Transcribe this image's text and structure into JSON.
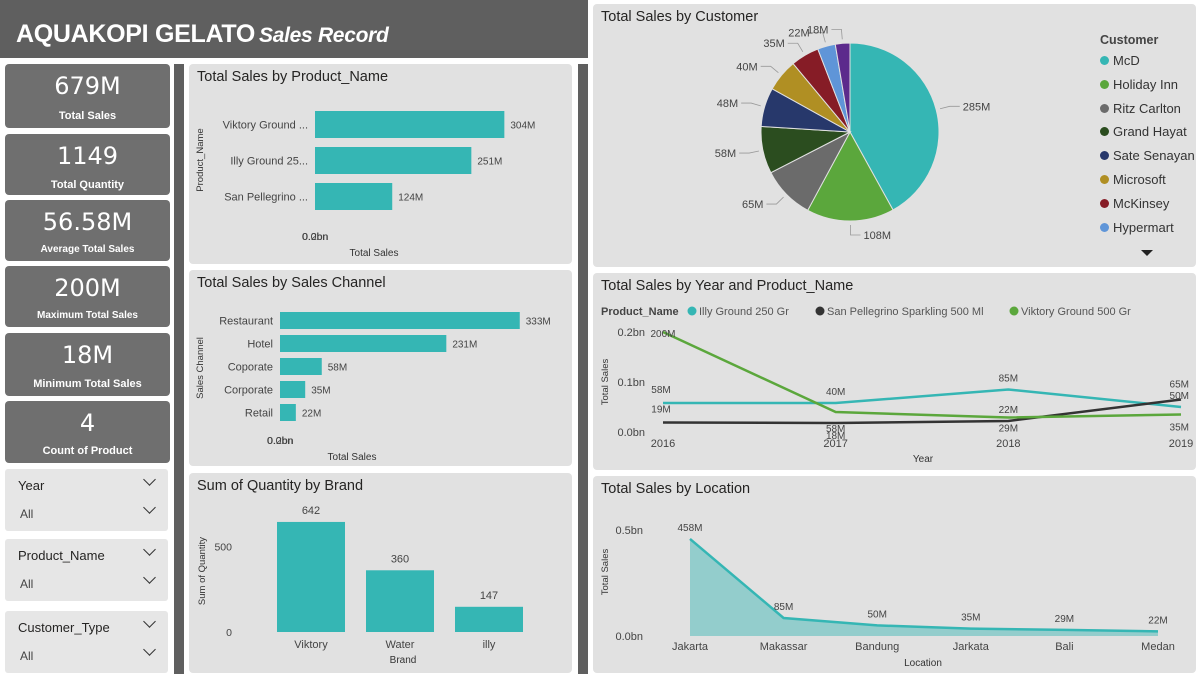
{
  "header": {
    "title": "AQUAKOPI GELATO",
    "subtitle": "Sales Record"
  },
  "kpis": [
    {
      "value": "679M",
      "label": "Total Sales"
    },
    {
      "value": "1149",
      "label": "Total Quantity"
    },
    {
      "value": "56.58M",
      "label": "Average Total Sales"
    },
    {
      "value": "200M",
      "label": "Maximum Total Sales"
    },
    {
      "value": "18M",
      "label": "Minimum Total Sales"
    },
    {
      "value": "4",
      "label": "Count of Product"
    }
  ],
  "slicers": [
    {
      "title": "Year",
      "value": "All"
    },
    {
      "title": "Product_Name",
      "value": "All"
    },
    {
      "title": "Customer_Type",
      "value": "All"
    }
  ],
  "colors": {
    "teal": "#35b6b4",
    "header": "#5f5f5f",
    "kpi": "#6f6f6f",
    "card": "#e1e1e1"
  },
  "chart_data": [
    {
      "id": "product",
      "type": "bar",
      "orientation": "horizontal",
      "title": "Total Sales by Product_Name",
      "xlabel": "Total Sales",
      "ylabel": "Product_Name",
      "categories": [
        "Viktory Ground ...",
        "Illy Ground 25...",
        "San Pellegrino ..."
      ],
      "values": [
        304,
        251,
        124
      ],
      "data_labels": [
        "304M",
        "251M",
        "124M"
      ],
      "xticks": [
        "0.0bn",
        "0.2bn"
      ],
      "xlim": [
        0,
        350
      ]
    },
    {
      "id": "channel",
      "type": "bar",
      "orientation": "horizontal",
      "title": "Total Sales by Sales Channel",
      "xlabel": "Total Sales",
      "ylabel": "Sales Channel",
      "categories": [
        "Restaurant",
        "Hotel",
        "Coporate",
        "Corporate",
        "Retail"
      ],
      "values": [
        333,
        231,
        58,
        35,
        22
      ],
      "data_labels": [
        "333M",
        "231M",
        "58M",
        "35M",
        "22M"
      ],
      "xticks": [
        "0.0bn",
        "0.2bn"
      ],
      "xlim": [
        0,
        350
      ]
    },
    {
      "id": "brand",
      "type": "bar",
      "title": "Sum of Quantity by Brand",
      "xlabel": "Brand",
      "ylabel": "Sum of Quantity",
      "categories": [
        "Viktory",
        "Water",
        "illy"
      ],
      "values": [
        642,
        360,
        147
      ],
      "data_labels": [
        "642",
        "360",
        "147"
      ],
      "yticks": [
        "0",
        "500"
      ],
      "ylim": [
        0,
        700
      ]
    },
    {
      "id": "customer",
      "type": "pie",
      "title": "Total Sales by Customer",
      "legend_title": "Customer",
      "legend": "right",
      "series": [
        {
          "name": "McD",
          "value": 285,
          "label": "285M",
          "color": "#35b6b4"
        },
        {
          "name": "Holiday Inn",
          "value": 108,
          "label": "108M",
          "color": "#5ba73c"
        },
        {
          "name": "Ritz Carlton",
          "value": 65,
          "label": "65M",
          "color": "#6b6b6b"
        },
        {
          "name": "Grand Hayat",
          "value": 58,
          "label": "58M",
          "color": "#2b4d1f"
        },
        {
          "name": "Sate Senayan",
          "value": 48,
          "label": "48M",
          "color": "#27386b"
        },
        {
          "name": "Microsoft",
          "value": 40,
          "label": "40M",
          "color": "#b08f23"
        },
        {
          "name": "McKinsey",
          "value": 35,
          "label": "35M",
          "color": "#861c26"
        },
        {
          "name": "Hypermart",
          "value": 22,
          "label": "22M",
          "color": "#5f95d8"
        },
        {
          "name": "",
          "value": 18,
          "label": "18M",
          "color": "#5c2a8c"
        }
      ]
    },
    {
      "id": "yearline",
      "type": "line",
      "title": "Total Sales by Year and Product_Name",
      "legend_title": "Product_Name",
      "legend": "top",
      "xlabel": "Year",
      "ylabel": "Total Sales",
      "x": [
        "2016",
        "2017",
        "2018",
        "2019"
      ],
      "yticks": [
        "0.0bn",
        "0.1bn",
        "0.2bn"
      ],
      "ylim": [
        0,
        200
      ],
      "series": [
        {
          "name": "Illy Ground 250 Gr",
          "color": "#35b6b4",
          "values": [
            58,
            58,
            85,
            50
          ],
          "labels": [
            "58M",
            "40M",
            "85M",
            "50M"
          ]
        },
        {
          "name": "San Pellegrino Sparkling 500 Ml",
          "color": "#333333",
          "values": [
            19,
            18,
            22,
            65
          ],
          "labels": [
            "19M",
            "18M",
            "22M",
            "65M"
          ]
        },
        {
          "name": "Viktory Ground 500 Gr",
          "color": "#5ba73c",
          "values": [
            200,
            40,
            29,
            35
          ],
          "labels": [
            "200M",
            "58M",
            "29M",
            "35M"
          ]
        }
      ]
    },
    {
      "id": "location",
      "type": "area",
      "title": "Total Sales by Location",
      "xlabel": "Location",
      "ylabel": "Total Sales",
      "categories": [
        "Jakarta",
        "Makassar",
        "Bandung",
        "Jarkata",
        "Bali",
        "Medan"
      ],
      "values": [
        458,
        85,
        50,
        35,
        29,
        22
      ],
      "data_labels": [
        "458M",
        "85M",
        "50M",
        "35M",
        "29M",
        "22M"
      ],
      "yticks": [
        "0.0bn",
        "0.5bn"
      ],
      "ylim": [
        0,
        520
      ]
    }
  ]
}
